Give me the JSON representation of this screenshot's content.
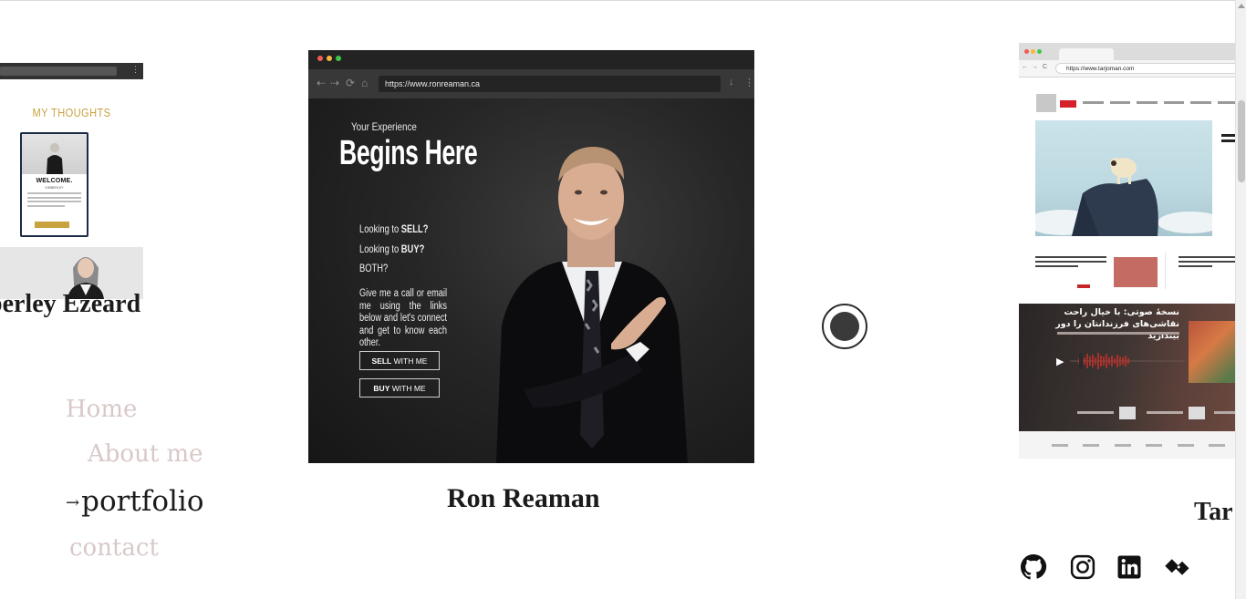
{
  "cards": [
    {
      "name": "Kimberley Ezeard",
      "display_name": "berley Ezeard",
      "screenshot": {
        "heading": "MY THOUGHTS",
        "welcome": "WELCOME.",
        "welcome_sub": "KIMBERLEY"
      }
    },
    {
      "name": "Ron Reaman",
      "screenshot": {
        "url": "https://www.ronreaman.ca",
        "kicker": "Your Experience",
        "headline": "Begins Here",
        "q1_pre": "Looking to ",
        "q1_bold": "SELL?",
        "q2_pre": "Looking to ",
        "q2_bold": "BUY?",
        "q3": "BOTH?",
        "body": "Give me a call or email me using the links below and let's connect and get to know each other.",
        "btn_sell_bold": "SELL",
        "btn_sell_rest": " WITH ME",
        "btn_buy_bold": "BUY",
        "btn_buy_rest": " WITH ME"
      }
    },
    {
      "name": "Tarjoman",
      "display_name": "Tar",
      "screenshot": {
        "url": "https://www.tarjoman.com",
        "audio_title": "نسخهٔ صوتی: با خیال راحت نقاشی‌های فرزندانتان را دور بیندازید"
      }
    }
  ],
  "nav": {
    "home": "Home",
    "about": "About me",
    "portfolio_arrow": "→",
    "portfolio": "portfolio",
    "contact": "contact"
  },
  "social_icons": [
    "github-icon",
    "instagram-icon",
    "linkedin-icon",
    "codepen-diamond-icon"
  ],
  "colors": {
    "nav_inactive": "#d9c8c8",
    "nav_active": "#1c1c1c",
    "gold": "#c8a23f",
    "tarjoman_red": "#d6202c"
  }
}
